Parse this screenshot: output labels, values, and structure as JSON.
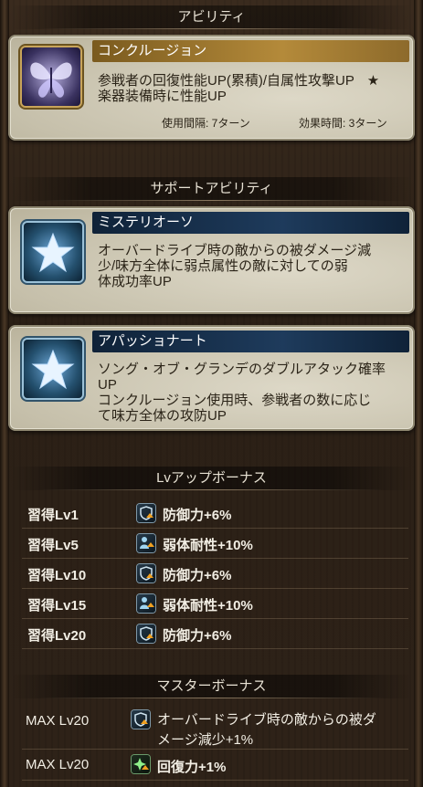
{
  "sections": {
    "ability": "アビリティ",
    "support": "サポートアビリティ",
    "lvup": "Lvアップボーナス",
    "master": "マスターボーナス"
  },
  "ability": {
    "name": "コンクルージョン",
    "desc_line1": "参戦者の回復性能UP(累積)/自属性攻撃UP",
    "star": "★",
    "desc_line2": "楽器装備時に性能UP",
    "cooldown": "使用間隔: 7ターン",
    "duration": "効果時間: 3ターン"
  },
  "support_abilities": [
    {
      "name": "ミステリオーソ",
      "lines": [
        "オーバードライブ時の敵からの被ダメージ減",
        "少/味方全体に弱点属性の敵に対しての弱",
        "体成功率UP"
      ]
    },
    {
      "name": "アパッショナート",
      "lines": [
        "ソング・オブ・グランデのダブルアタック確率",
        "UP",
        "コンクルージョン使用時、参戦者の数に応じ",
        "て味方全体の攻防UP"
      ]
    }
  ],
  "lv_bonus": [
    {
      "level": "習得Lv1",
      "icon": "defense-up-icon",
      "text": "防御力+6%"
    },
    {
      "level": "習得Lv5",
      "icon": "weaken-resist-icon",
      "text": "弱体耐性+10%"
    },
    {
      "level": "習得Lv10",
      "icon": "defense-up-icon",
      "text": "防御力+6%"
    },
    {
      "level": "習得Lv15",
      "icon": "weaken-resist-icon",
      "text": "弱体耐性+10%"
    },
    {
      "level": "習得Lv20",
      "icon": "defense-up-icon",
      "text": "防御力+6%"
    }
  ],
  "master_bonus": [
    {
      "level": "MAX Lv20",
      "icon": "defense-up-icon",
      "line1": "オーバードライブ時の敵からの被ダ",
      "line2": "メージ減少+1%"
    },
    {
      "level": "MAX Lv20",
      "icon": "heal-up-icon",
      "text": "回復力+1%"
    }
  ],
  "colors": {
    "gold_header": "#b48a3a",
    "navy_header": "#1e3b5c",
    "card_bg": "#cfcab8"
  }
}
